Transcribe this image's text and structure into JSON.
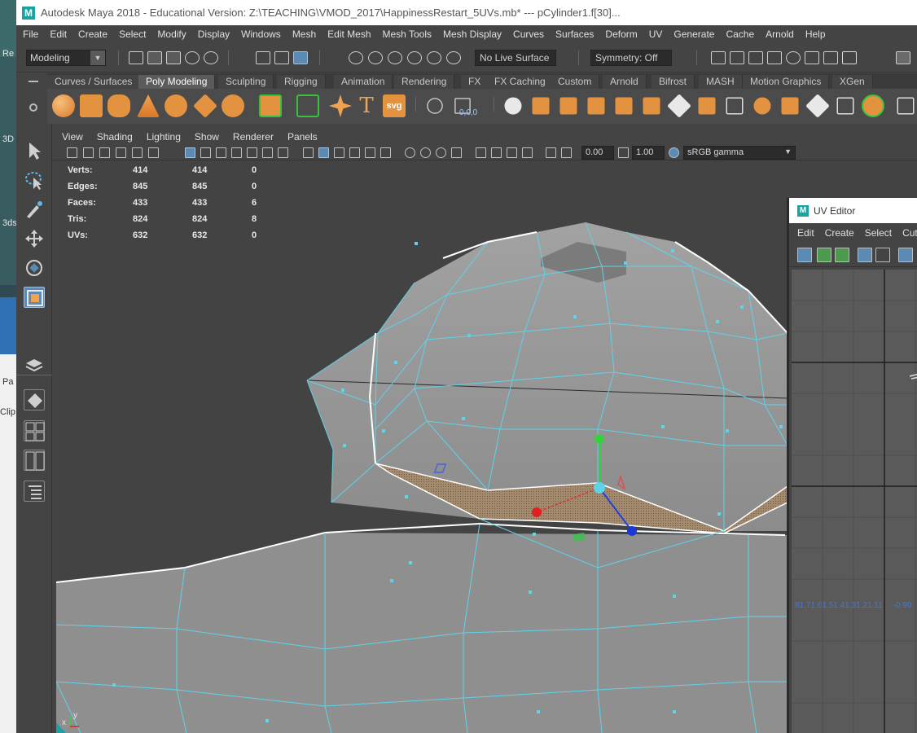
{
  "window": {
    "title": "Autodesk Maya 2018 - Educational Version: Z:\\TEACHING\\VMOD_2017\\HappinessRestart_5UVs.mb*   ---   pCylinder1.f[30]...",
    "logo_letter": "M"
  },
  "desktop": {
    "labels": [
      "Re",
      "3D",
      "3ds",
      "Pa",
      "Clip"
    ]
  },
  "menubar": {
    "items": [
      "File",
      "Edit",
      "Create",
      "Select",
      "Modify",
      "Display",
      "Windows",
      "Mesh",
      "Edit Mesh",
      "Mesh Tools",
      "Mesh Display",
      "Curves",
      "Surfaces",
      "Deform",
      "UV",
      "Generate",
      "Cache",
      "Arnold",
      "Help"
    ]
  },
  "statusline": {
    "mode": "Modeling",
    "live_surface": "No Live Surface",
    "symmetry": "Symmetry: Off"
  },
  "shelf": {
    "tabs": [
      "Curves / Surfaces",
      "Poly Modeling",
      "Sculpting",
      "Rigging",
      "Animation",
      "Rendering",
      "FX",
      "FX Caching",
      "Custom",
      "Arnold",
      "Bifrost",
      "MASH",
      "Motion Graphics",
      "XGen"
    ],
    "active_tab": "Poly Modeling",
    "text_icons": {
      "type": "T",
      "svg": "svg",
      "coords": "0,0,0"
    }
  },
  "panel": {
    "menu": [
      "View",
      "Shading",
      "Lighting",
      "Show",
      "Renderer",
      "Panels"
    ],
    "near_value": "0.00",
    "far_value": "1.00",
    "color_space": "sRGB gamma"
  },
  "hud": {
    "rows": [
      {
        "label": "Verts:",
        "a": "414",
        "b": "414",
        "c": "0"
      },
      {
        "label": "Edges:",
        "a": "845",
        "b": "845",
        "c": "0"
      },
      {
        "label": "Faces:",
        "a": "433",
        "b": "433",
        "c": "6"
      },
      {
        "label": "Tris:",
        "a": "824",
        "b": "824",
        "c": "8"
      },
      {
        "label": "UVs:",
        "a": "632",
        "b": "632",
        "c": "0"
      }
    ]
  },
  "axis": {
    "x_label": "x",
    "y_label": "y"
  },
  "uv_editor": {
    "title": "UV Editor",
    "menu": [
      "Edit",
      "Create",
      "Select",
      "Cut"
    ],
    "ruler_text": "81.71.61.51.41.31.21.11",
    "ruler_value": "-0.90"
  },
  "colors": {
    "accent": "#5b8bb5",
    "wire": "#5fd3e8",
    "selection_white": "#ffffff",
    "shelf_orange": "#e8913a"
  }
}
